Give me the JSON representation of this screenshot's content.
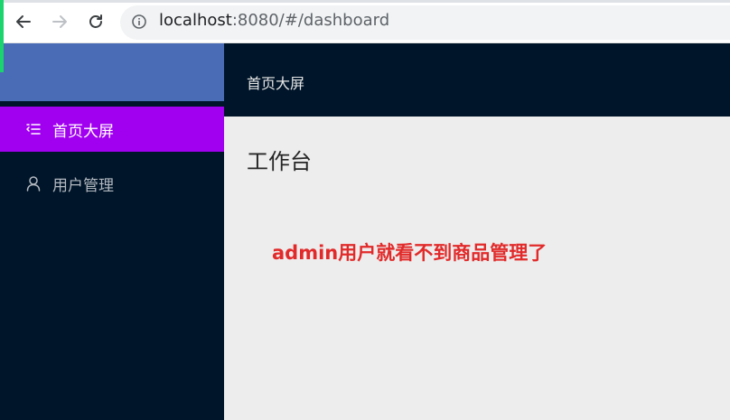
{
  "browser": {
    "url_host": "localhost",
    "url_rest": ":8080/#/dashboard"
  },
  "sidebar": {
    "items": [
      {
        "label": "首页大屏",
        "icon": "menu-indent-icon",
        "active": true
      },
      {
        "label": "用户管理",
        "icon": "user-icon",
        "active": false
      }
    ]
  },
  "header": {
    "title": "首页大屏"
  },
  "main": {
    "title": "工作台",
    "annotation": "admin用户就看不到商品管理了"
  },
  "colors": {
    "sidebar_bg": "#001529",
    "logo_bg": "#4a6cb7",
    "active_bg": "#a100f0",
    "annotation": "#e22a2a",
    "accent_green": "#1bd46e"
  }
}
